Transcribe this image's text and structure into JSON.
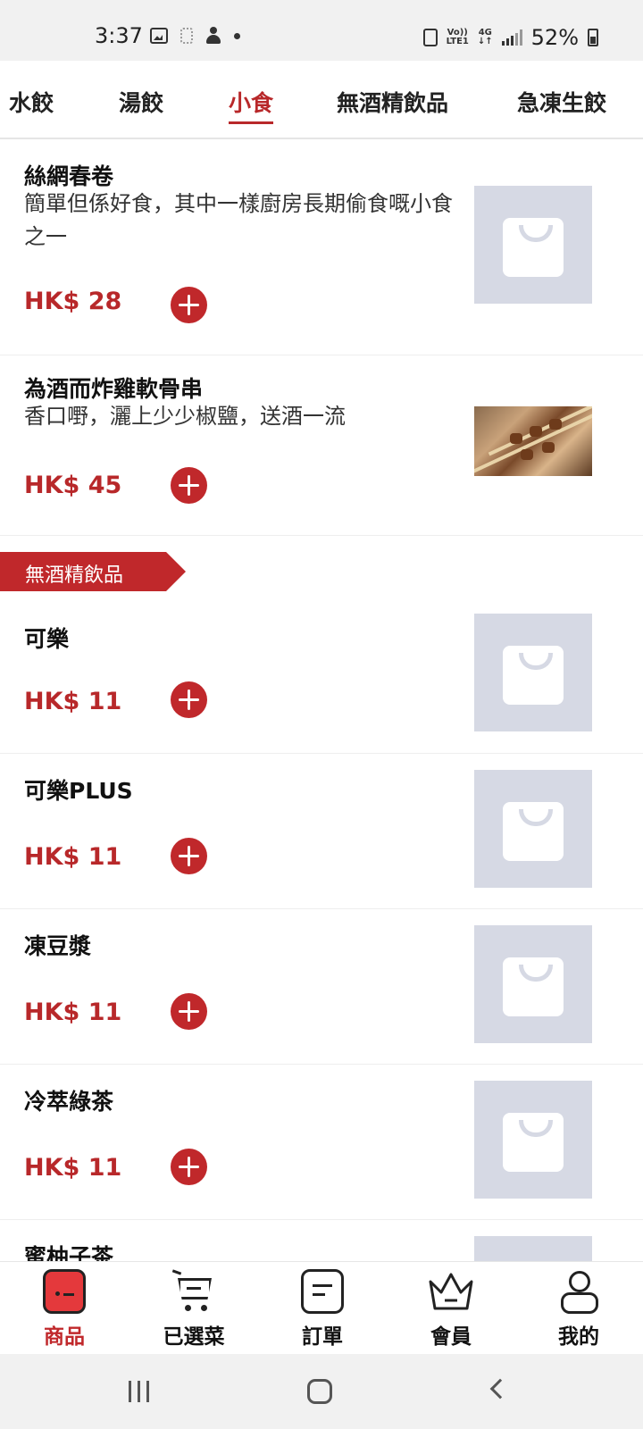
{
  "status_bar": {
    "time": "3:37",
    "battery": "52%",
    "network_lte": "Vo)) LTE1",
    "network_4g": "4G"
  },
  "tabs": [
    {
      "label": "水餃"
    },
    {
      "label": "湯餃"
    },
    {
      "label": "小食",
      "active": true
    },
    {
      "label": "無酒精飲品"
    },
    {
      "label": "急凍生餃"
    }
  ],
  "items": [
    {
      "name": "絲網春卷",
      "desc": "簡單但係好食，其中一樣廚房長期偷食嘅小食之一",
      "price": "HK$ 28"
    },
    {
      "name": "為酒而炸雞軟骨串",
      "desc": "香口嘢，灑上少少椒鹽，送酒一流",
      "price": "HK$ 45"
    }
  ],
  "category": {
    "label": "無酒精飲品"
  },
  "drinks": [
    {
      "name": "可樂",
      "price": "HK$ 11"
    },
    {
      "name": "可樂PLUS",
      "price": "HK$ 11"
    },
    {
      "name": "凍豆漿",
      "price": "HK$ 11"
    },
    {
      "name": "冷萃綠茶",
      "price": "HK$ 11"
    },
    {
      "name": "蜜柚子茶"
    }
  ],
  "bottom_nav": [
    {
      "label": "商品",
      "icon": "shop-icon",
      "active": true
    },
    {
      "label": "已選菜",
      "icon": "cart-icon"
    },
    {
      "label": "訂單",
      "icon": "order-icon"
    },
    {
      "label": "會員",
      "icon": "crown-icon"
    },
    {
      "label": "我的",
      "icon": "person-icon"
    }
  ],
  "colors": {
    "accent": "#c0282b",
    "placeholder": "#d6d9e4"
  }
}
